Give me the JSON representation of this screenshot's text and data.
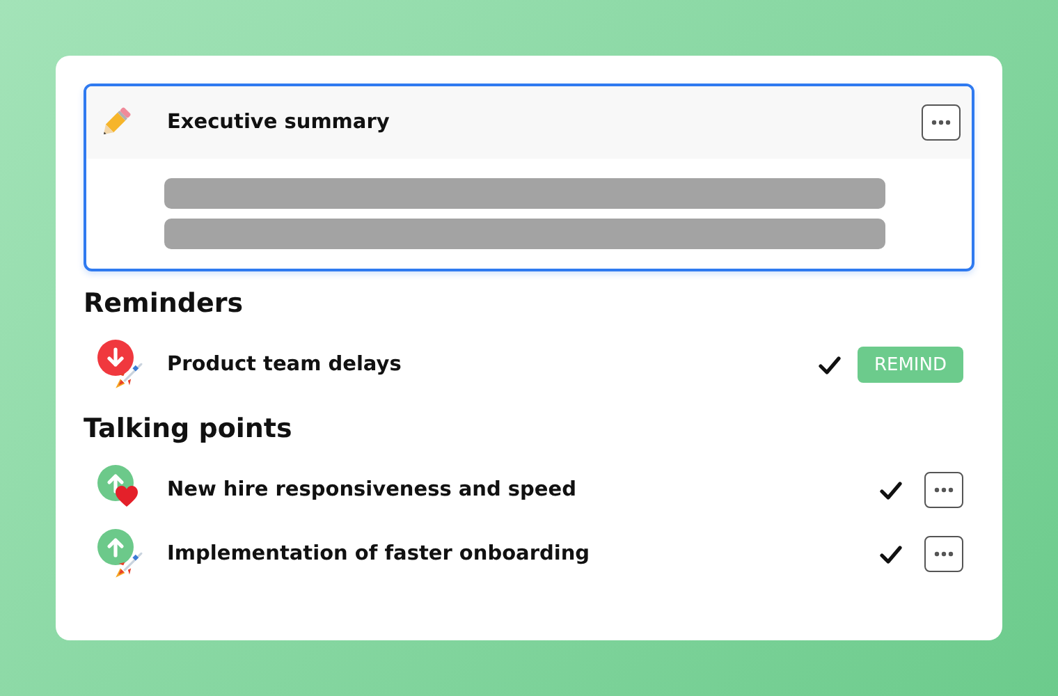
{
  "summary": {
    "title": "Executive summary"
  },
  "sections": [
    {
      "heading": "Reminders",
      "items": [
        {
          "title": "Product team delays",
          "status": {
            "kind": "down",
            "color": "#f0383e"
          },
          "emoji": {
            "kind": "rocket"
          },
          "checked": true,
          "action": {
            "kind": "button",
            "label": "REMIND"
          }
        }
      ]
    },
    {
      "heading": "Talking points",
      "items": [
        {
          "title": "New hire responsiveness and speed",
          "status": {
            "kind": "up",
            "color": "#6cc98a"
          },
          "emoji": {
            "kind": "heart"
          },
          "checked": true,
          "action": {
            "kind": "more"
          }
        },
        {
          "title": "Implementation of faster onboarding",
          "status": {
            "kind": "up",
            "color": "#6cc98a"
          },
          "emoji": {
            "kind": "rocket"
          },
          "checked": true,
          "action": {
            "kind": "more"
          }
        }
      ]
    }
  ]
}
